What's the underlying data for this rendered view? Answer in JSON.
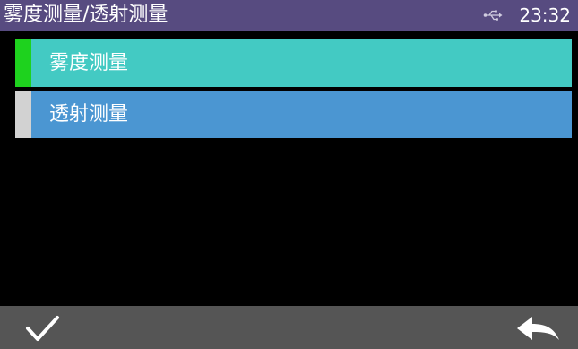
{
  "header": {
    "title": "雾度测量/透射测量",
    "time": "23:32",
    "connection_icon": "usb-icon"
  },
  "menu": {
    "items": [
      {
        "label": "雾度测量",
        "selected": true,
        "background": "#43cac3",
        "indicator": "#1ed21e"
      },
      {
        "label": "透射测量",
        "selected": false,
        "background": "#4b96d2",
        "indicator": "#d2d2d2"
      }
    ]
  },
  "footer": {
    "confirm_icon": "check-icon",
    "back_icon": "back-arrow-icon"
  },
  "colors": {
    "title_bar": "#574b80",
    "background": "#000000",
    "bottom_bar": "#555555",
    "text": "#ffffff"
  }
}
